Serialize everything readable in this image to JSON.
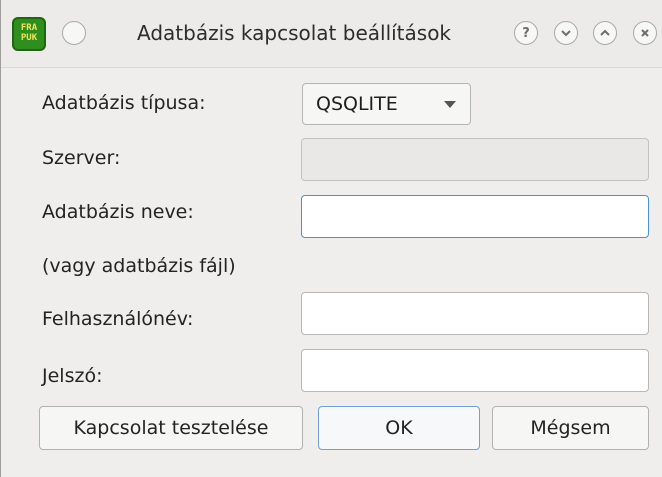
{
  "window": {
    "title": "Adatbázis kapcsolat beállítások",
    "app_icon_text": "FRA\nPUK",
    "title_buttons": [
      "help",
      "minimize",
      "maximize",
      "close"
    ],
    "help_glyph": "?"
  },
  "form": {
    "db_type_label": "Adatbázis típusa:",
    "db_type_value": "QSQLITE",
    "server_label": "Szerver:",
    "server_value": "",
    "db_name_label": "Adatbázis neve:",
    "db_name_sublabel": "(vagy adatbázis fájl)",
    "db_name_value": "",
    "username_label": "Felhasználónév:",
    "username_value": "",
    "password_label": "Jelszó:",
    "password_value": ""
  },
  "buttons": {
    "test_label": "Kapcsolat tesztelése",
    "ok_label": "OK",
    "cancel_label": "Mégsem"
  },
  "colors": {
    "focus_accent": "#4a90d9",
    "app_icon_bg": "#2f8f1e",
    "app_icon_fg": "#f3e35b"
  }
}
